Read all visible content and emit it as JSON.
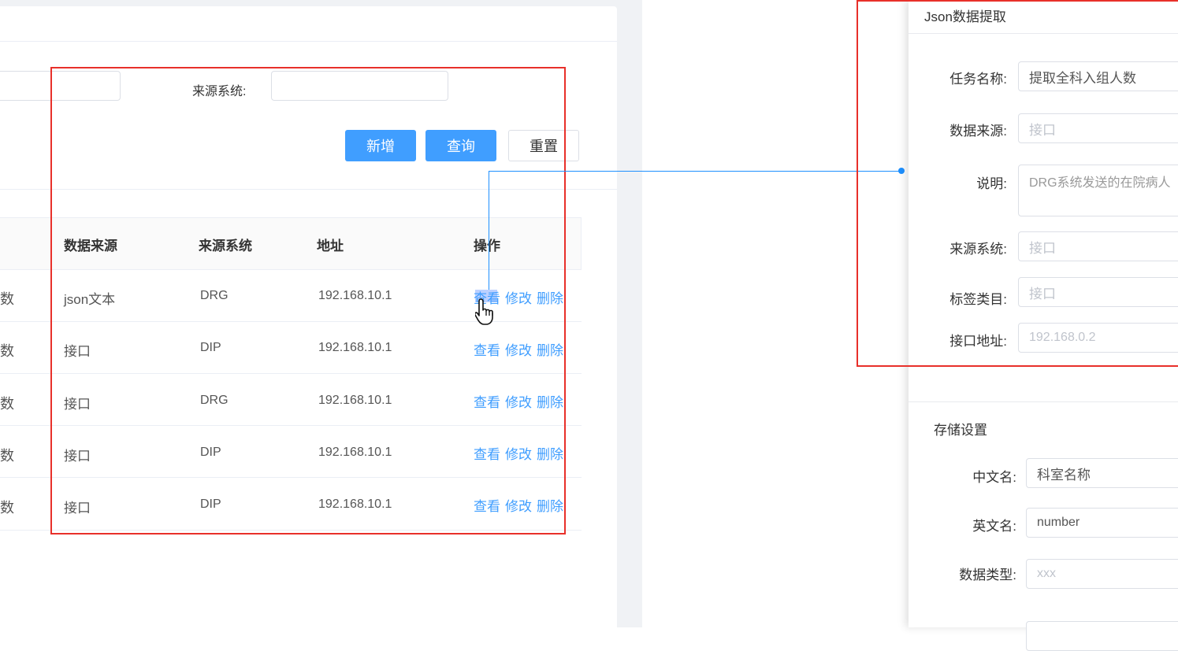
{
  "filter": {
    "source_system_label": "来源系统:",
    "add_button": "新增",
    "query_button": "查询",
    "reset_button": "重置"
  },
  "table": {
    "headers": [
      "数据来源",
      "来源系统",
      "地址",
      "操作"
    ],
    "rows": [
      {
        "name_tail": "数",
        "source": "json文本",
        "system": "DRG",
        "address": "192.168.10.1"
      },
      {
        "name_tail": "数",
        "source": "接口",
        "system": "DIP",
        "address": "192.168.10.1"
      },
      {
        "name_tail": "数",
        "source": "接口",
        "system": "DRG",
        "address": "192.168.10.1"
      },
      {
        "name_tail": "数",
        "source": "接口",
        "system": "DIP",
        "address": "192.168.10.1"
      },
      {
        "name_tail": "数",
        "source": "接口",
        "system": "DIP",
        "address": "192.168.10.1"
      }
    ],
    "actions": {
      "view": "查看",
      "edit": "修改",
      "delete": "删除"
    }
  },
  "panel": {
    "title": "Json数据提取",
    "fields": {
      "task_name": {
        "label": "任务名称:",
        "value": "提取全科入组人数"
      },
      "data_source": {
        "label": "数据来源:",
        "placeholder": "接口"
      },
      "description": {
        "label": "说明:",
        "value": "DRG系统发送的在院病人"
      },
      "source_system": {
        "label": "来源系统:",
        "placeholder": "接口"
      },
      "tag_category": {
        "label": "标签类目:",
        "placeholder": "接口"
      },
      "api_address": {
        "label": "接口地址:",
        "placeholder": "192.168.0.2"
      }
    },
    "storage": {
      "title": "存储设置",
      "cn_name": {
        "label": "中文名:",
        "value": "科室名称"
      },
      "en_name": {
        "label": "英文名:",
        "value": "number"
      },
      "data_type": {
        "label": "数据类型:",
        "placeholder": "xxx"
      }
    }
  },
  "colors": {
    "primary": "#409eff",
    "annotation_red": "#e8302a",
    "connector_blue": "#1e90ff"
  }
}
